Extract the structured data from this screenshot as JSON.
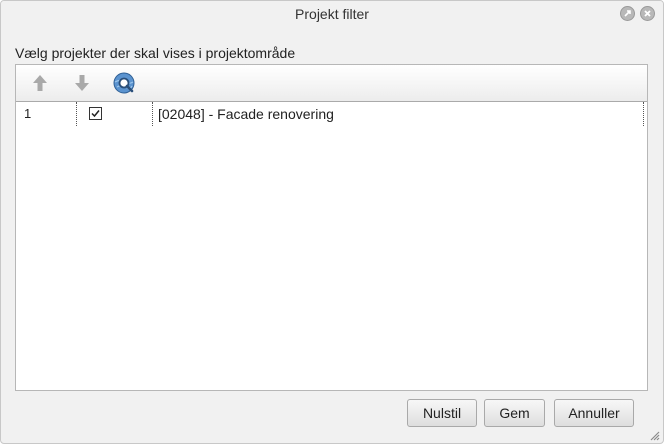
{
  "window": {
    "title": "Projekt filter"
  },
  "instruction": "Vælg projekter der skal vises i projektområde",
  "toolbar": {
    "icons": [
      "arrow-up-icon",
      "arrow-down-icon",
      "search-globe-icon"
    ]
  },
  "rows": [
    {
      "number": "1",
      "checked": true,
      "name": "[02048] - Facade renovering"
    }
  ],
  "buttons": {
    "reset_label": "Nulstil",
    "save_label": "Gem",
    "cancel_label": "Annuller"
  },
  "colors": {
    "dialog_background": "#f1f1f1",
    "panel_background": "#ffffff",
    "arrow_icon": "#a9a9a9",
    "search_icon": "#3f78b5"
  }
}
